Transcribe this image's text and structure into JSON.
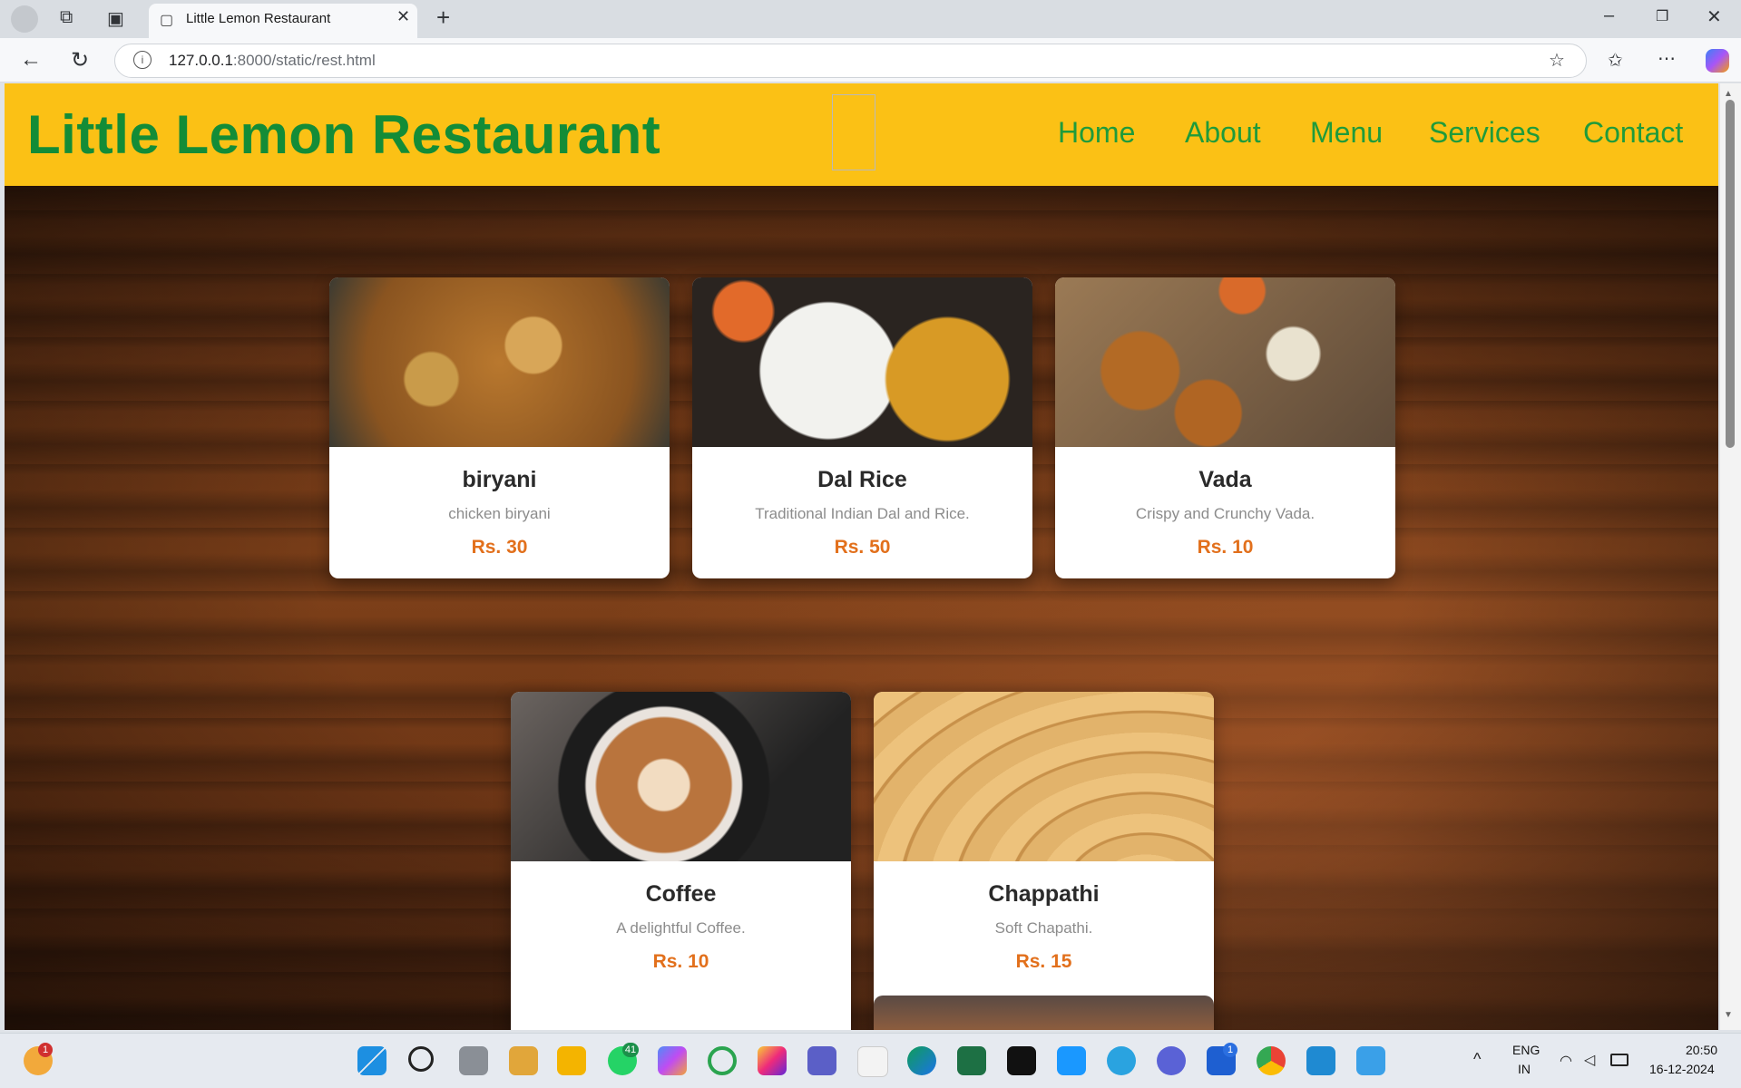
{
  "browser": {
    "tab_title": "Little Lemon Restaurant",
    "url_host": "127.0.0.1",
    "url_rest": ":8000/static/rest.html"
  },
  "site": {
    "brand": "Little Lemon Restaurant",
    "nav": [
      "Home",
      "About",
      "Menu",
      "Services",
      "Contact"
    ]
  },
  "menu_items": [
    {
      "name": "biryani",
      "desc": "chicken biryani",
      "price": "Rs. 30"
    },
    {
      "name": "Dal Rice",
      "desc": "Traditional Indian Dal and Rice.",
      "price": "Rs. 50"
    },
    {
      "name": "Vada",
      "desc": "Crispy and Crunchy Vada.",
      "price": "Rs. 10"
    },
    {
      "name": "Coffee",
      "desc": "A delightful Coffee.",
      "price": "Rs. 10"
    },
    {
      "name": "Chappathi",
      "desc": "Soft Chapathi.",
      "price": "Rs. 15"
    }
  ],
  "taskbar": {
    "lang_1": "ENG",
    "lang_2": "IN",
    "time": "20:50",
    "date": "16-12-2024",
    "whatsapp_badge": "41",
    "weather_badge": "1",
    "app_badge": "1"
  },
  "colors": {
    "header_bg": "#fbc115",
    "brand_green": "#138c37",
    "price_orange": "#e2701c"
  }
}
